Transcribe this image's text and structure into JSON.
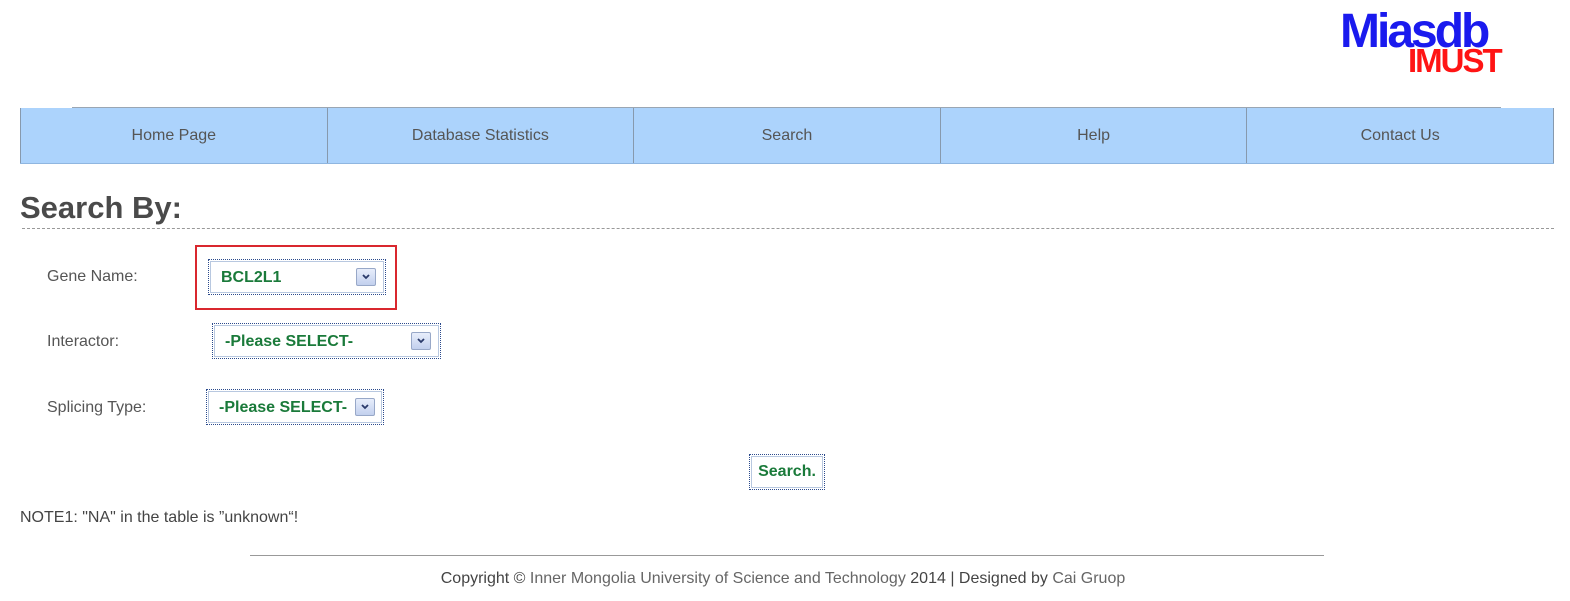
{
  "logo": {
    "main": "Miasdb",
    "sub": "IMUST"
  },
  "nav": {
    "items": [
      {
        "label": "Home Page"
      },
      {
        "label": "Database Statistics"
      },
      {
        "label": "Search"
      },
      {
        "label": "Help"
      },
      {
        "label": "Contact Us"
      }
    ]
  },
  "search": {
    "title": "Search By:",
    "fields": {
      "gene_name": {
        "label": "Gene Name:",
        "value": "BCL2L1"
      },
      "interactor": {
        "label": "Interactor:",
        "value": "-Please SELECT-"
      },
      "splicing_type": {
        "label": "Splicing Type:",
        "value": "-Please SELECT-"
      }
    },
    "button_label": "Search."
  },
  "note": "NOTE1: \"NA\" in the table is ”unknown“!",
  "footer": {
    "prefix": "Copyright © ",
    "university": "Inner Mongolia University of Science and Technology",
    "middle": " 2014 | Designed by ",
    "group": "Cai Gruop"
  },
  "colors": {
    "nav_background": "#acd3fc",
    "select_text": "#1a7a3a",
    "highlight": "#d9272e",
    "logo_blue": "#1a1aee",
    "logo_red": "#ff1414"
  },
  "icons": {
    "dropdown": "chevron-down-icon"
  }
}
